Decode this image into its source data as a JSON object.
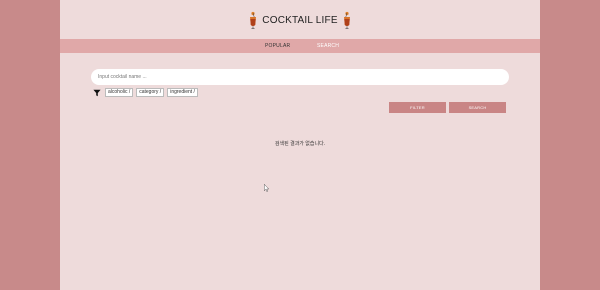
{
  "header": {
    "title": "COCKTAIL LIFE",
    "left_icon": "cocktail-glass-icon",
    "right_icon": "cocktail-glass-icon"
  },
  "nav": {
    "items": [
      {
        "label": "POPULAR"
      },
      {
        "label": "SEARCH"
      }
    ]
  },
  "search": {
    "placeholder": "Input cocktail name ...",
    "value": ""
  },
  "filters": {
    "icon": "funnel-icon",
    "chips": [
      {
        "label": "alcoholic /"
      },
      {
        "label": "category /"
      },
      {
        "label": "ingredient /"
      }
    ]
  },
  "actions": {
    "filter_label": "FILTER",
    "search_label": "SEARCH"
  },
  "results": {
    "empty_message": "검색된 결과가 없습니다."
  },
  "colors": {
    "outer_background": "#c88a8a",
    "page_background": "#eedbdb",
    "nav_background": "#e0a8a8",
    "button_background": "#c98585"
  }
}
